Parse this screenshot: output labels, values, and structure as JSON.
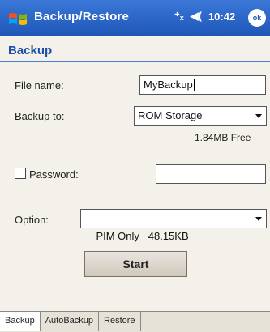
{
  "titlebar": {
    "title": "Backup/Restore",
    "time": "10:42",
    "signal_icon": "antenna-icon",
    "volume_icon": "speaker-icon",
    "ok_label": ""
  },
  "header": {
    "title": "Backup"
  },
  "form": {
    "file_name_label": "File name:",
    "file_name_value": "MyBackup",
    "backup_to_label": "Backup to:",
    "backup_to_value": "ROM Storage",
    "free_space": "1.84MB Free",
    "password_label": "Password:",
    "password_value": "",
    "option_label": "Option:",
    "option_value": "PIM Only   48.15KB",
    "start_label": "Start"
  },
  "tabs": [
    {
      "label": "Backup"
    },
    {
      "label": "AutoBackup"
    },
    {
      "label": "Restore"
    }
  ]
}
